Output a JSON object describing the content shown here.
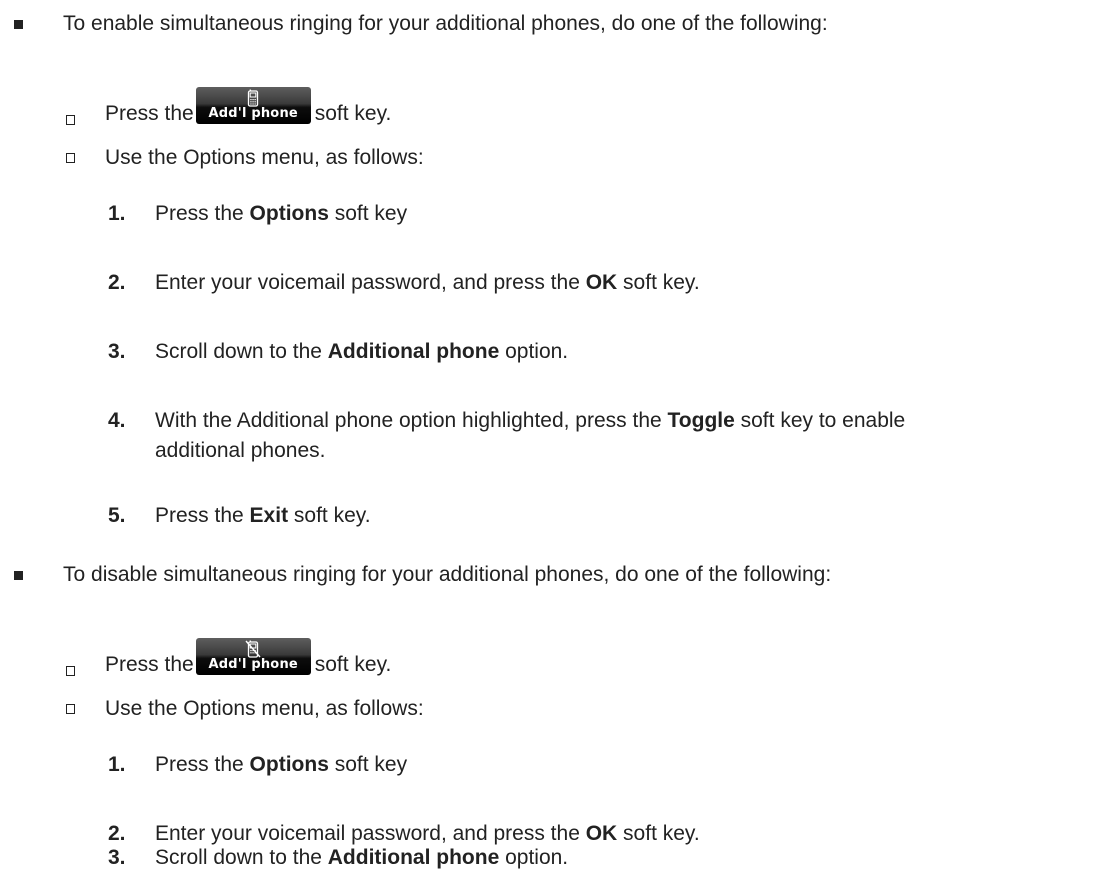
{
  "enable": {
    "intro": "To enable simultaneous ringing for your additional phones, do one of the following:",
    "press_prefix": "Press the",
    "press_suffix": "soft key.",
    "softkey_label": "Add'l phone",
    "softkey_icon": "mobile-phone-icon",
    "options_intro": "Use the Options menu, as follows:",
    "steps": [
      {
        "num": "1.",
        "before": "Press the ",
        "bold": "Options",
        "after": " soft key"
      },
      {
        "num": "2.",
        "before": "Enter your voicemail password, and press the ",
        "bold": "OK",
        "after": " soft key."
      },
      {
        "num": "3.",
        "before": "Scroll down to the ",
        "bold": "Additional phone",
        "after": " option."
      },
      {
        "num": "4.",
        "before": "With the Additional phone option highlighted, press the ",
        "bold": "Toggle",
        "after": " soft key to enable",
        "cont": "additional phones."
      },
      {
        "num": "5.",
        "before": "Press the ",
        "bold": "Exit",
        "after": " soft key."
      }
    ]
  },
  "disable": {
    "intro": "To disable simultaneous ringing for your additional phones, do one of the following:",
    "press_prefix": "Press the",
    "press_suffix": "soft key.",
    "softkey_label": "Add'l phone",
    "softkey_icon": "mobile-phone-crossed-icon",
    "options_intro": "Use the Options menu, as follows:",
    "steps": [
      {
        "num": "1.",
        "before": "Press the ",
        "bold": "Options",
        "after": " soft key"
      },
      {
        "num": "2.",
        "before": "Enter your voicemail password, and press the ",
        "bold": "OK",
        "after": " soft key."
      },
      {
        "num": "3.",
        "before": "Scroll down to the ",
        "bold": "Additional phone",
        "after": " option."
      }
    ]
  }
}
